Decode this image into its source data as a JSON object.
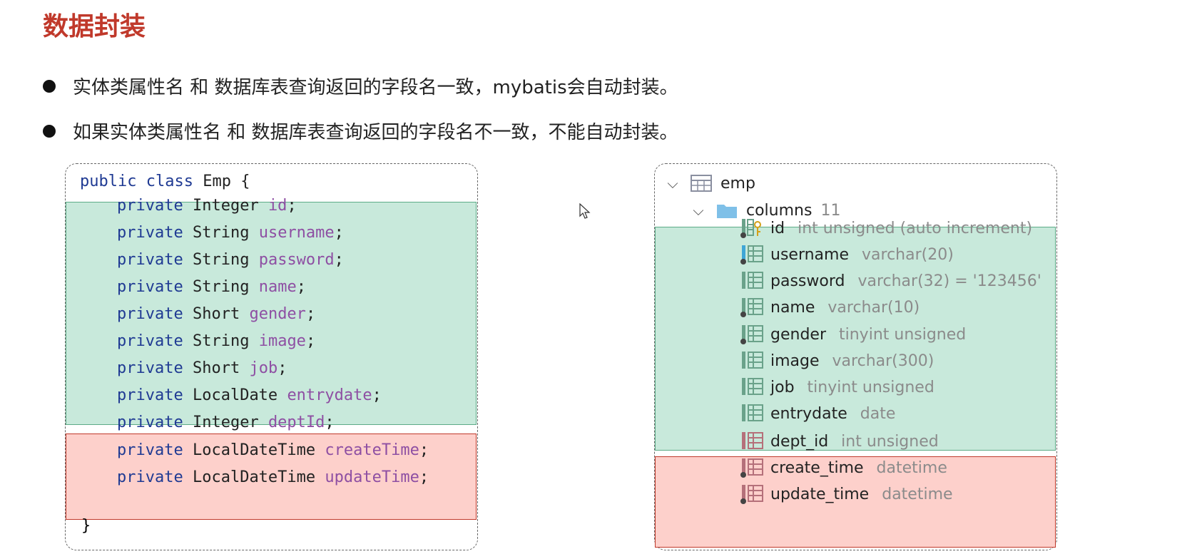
{
  "title": "数据封装",
  "bullets": [
    "实体类属性名 和 数据库表查询返回的字段名一致，mybatis会自动封装。",
    "如果实体类属性名 和 数据库表查询返回的字段名不一致，不能自动封装。"
  ],
  "code": {
    "header": {
      "kw1": "public",
      "kw2": "class",
      "name": "Emp",
      "brace": "{"
    },
    "fields": [
      {
        "kw": "private",
        "type": "Integer",
        "name": "id"
      },
      {
        "kw": "private",
        "type": "String",
        "name": "username"
      },
      {
        "kw": "private",
        "type": "String",
        "name": "password"
      },
      {
        "kw": "private",
        "type": "String",
        "name": "name"
      },
      {
        "kw": "private",
        "type": "Short",
        "name": "gender"
      },
      {
        "kw": "private",
        "type": "String",
        "name": "image"
      },
      {
        "kw": "private",
        "type": "Short",
        "name": "job"
      },
      {
        "kw": "private",
        "type": "LocalDate",
        "name": "entrydate"
      },
      {
        "kw": "private",
        "type": "Integer",
        "name": "deptId"
      },
      {
        "kw": "private",
        "type": "LocalDateTime",
        "name": "createTime"
      },
      {
        "kw": "private",
        "type": "LocalDateTime",
        "name": "updateTime"
      }
    ],
    "closing": "}"
  },
  "db": {
    "table": "emp",
    "columns_label": "columns",
    "columns_count": "11",
    "columns": [
      {
        "name": "id",
        "type": "int unsigned (auto increment)"
      },
      {
        "name": "username",
        "type": "varchar(20)"
      },
      {
        "name": "password",
        "type": "varchar(32) = '123456'"
      },
      {
        "name": "name",
        "type": "varchar(10)"
      },
      {
        "name": "gender",
        "type": "tinyint unsigned"
      },
      {
        "name": "image",
        "type": "varchar(300)"
      },
      {
        "name": "job",
        "type": "tinyint unsigned"
      },
      {
        "name": "entrydate",
        "type": "date"
      },
      {
        "name": "dept_id",
        "type": "int unsigned"
      },
      {
        "name": "create_time",
        "type": "datetime"
      },
      {
        "name": "update_time",
        "type": "datetime"
      }
    ]
  },
  "colors": {
    "title": "#c0392b",
    "match_bg": "#c8e9db",
    "mismatch_bg": "#fdd0cb",
    "keyword": "#1f3a93",
    "field": "#8e4fa3"
  }
}
